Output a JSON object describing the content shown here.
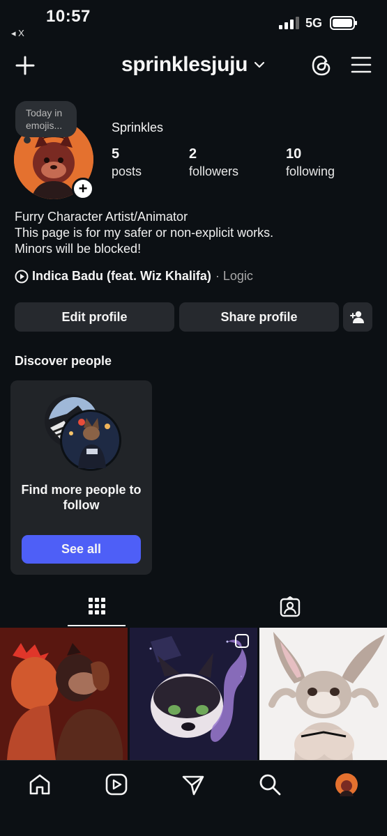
{
  "status": {
    "time": "10:57",
    "back_label": "◂ X",
    "network": "5G"
  },
  "header": {
    "username": "sprinklesjuju"
  },
  "note": {
    "text": "Today in emojis..."
  },
  "profile": {
    "display_name": "Sprinkles",
    "stats": [
      {
        "value": "5",
        "label": "posts"
      },
      {
        "value": "2",
        "label": "followers"
      },
      {
        "value": "10",
        "label": "following"
      }
    ],
    "bio": [
      "Furry Character Artist/Animator",
      "This page is for my safer or non-explicit works.",
      "Minors will be blocked!"
    ],
    "music": {
      "title": "Indica Badu (feat. Wiz Khalifa)",
      "artist": "· Logic"
    }
  },
  "actions": {
    "edit_label": "Edit profile",
    "share_label": "Share profile"
  },
  "discover": {
    "title": "Discover people",
    "card_text": "Find more people to follow",
    "button_label": "See all"
  },
  "tabs": [
    "grid-icon",
    "tagged-icon"
  ],
  "nav": [
    "home-icon",
    "reels-icon",
    "direct-message-icon",
    "search-icon",
    "profile-avatar"
  ],
  "colors": {
    "background": "#0c1014",
    "surface": "#26292e",
    "accent": "#4e5ff7"
  }
}
